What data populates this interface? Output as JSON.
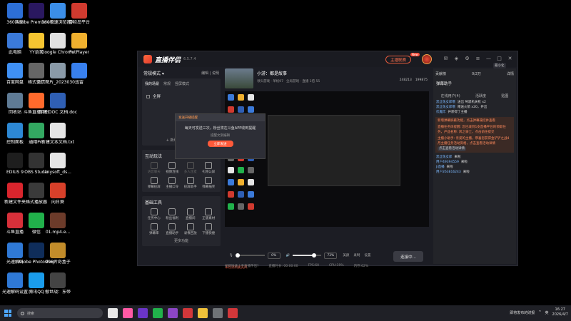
{
  "desktop_icons": [
    {
      "label": "360压缩",
      "color": "#2d6fd6",
      "col": 0,
      "row": 0
    },
    {
      "label": "Adobe Premiere P...",
      "color": "#2a1860",
      "col": 1,
      "row": 0
    },
    {
      "label": "360极速浏览器X",
      "color": "#3b8ee8",
      "col": 2,
      "row": 0
    },
    {
      "label": "冒险岛平台",
      "color": "#d03a2f",
      "col": 3,
      "row": 0
    },
    {
      "label": "此电脑",
      "color": "#3b7ad9",
      "col": 0,
      "row": 1
    },
    {
      "label": "YY语音",
      "color": "#f5c531",
      "col": 1,
      "row": 1
    },
    {
      "label": "Google Chrome",
      "color": "#e0e0e0",
      "col": 2,
      "row": 1
    },
    {
      "label": "PotPlayer",
      "color": "#f0b02e",
      "col": 3,
      "row": 1
    },
    {
      "label": "百度网盘",
      "color": "#3f90f4",
      "col": 0,
      "row": 2
    },
    {
      "label": "格式工厂",
      "color": "#666666",
      "col": 1,
      "row": 2
    },
    {
      "label": "微信图片_2023030...",
      "color": "#8a9aa8",
      "col": 2,
      "row": 2
    },
    {
      "label": "迅雷",
      "color": "#3880ee",
      "col": 3,
      "row": 2
    },
    {
      "label": "回收站",
      "color": "#5f7b95",
      "col": 0,
      "row": 3
    },
    {
      "label": "斗鱼直播伴侣",
      "color": "#ff6a2c",
      "col": 1,
      "row": 3
    },
    {
      "label": "新建 DOC 文档.doc",
      "color": "#2f5fb4",
      "col": 2,
      "row": 3
    },
    {
      "label": "控制面板",
      "color": "#2d88d4",
      "col": 0,
      "row": 4
    },
    {
      "label": "通翔Pro",
      "color": "#33a861",
      "col": 1,
      "row": 4
    },
    {
      "label": "新建文本文档.txt",
      "color": "#e5e5e5",
      "col": 2,
      "row": 4
    },
    {
      "label": "EDIUS 9",
      "color": "#1e1e1e",
      "col": 0,
      "row": 5
    },
    {
      "label": "OBS Studio",
      "color": "#333333",
      "col": 1,
      "row": 5
    },
    {
      "label": "anysoft_ds...",
      "color": "#e5e5e5",
      "col": 2,
      "row": 5
    },
    {
      "label": "新建文件夹",
      "color": "#d9252d",
      "col": 0,
      "row": 6
    },
    {
      "label": "格式播放器",
      "color": "#3a3a3a",
      "col": 1,
      "row": 6
    },
    {
      "label": "向日葵",
      "color": "#d7402a",
      "col": 2,
      "row": 6
    },
    {
      "label": "斗鱼直播",
      "color": "#d7303a",
      "col": 0,
      "row": 7
    },
    {
      "label": "微信",
      "color": "#21b14b",
      "col": 1,
      "row": 7
    },
    {
      "label": "01.mp4.e...",
      "color": "#6c3b2a",
      "col": 2,
      "row": 7
    },
    {
      "label": "光速解码",
      "color": "#2f79d6",
      "col": 0,
      "row": 8
    },
    {
      "label": "Adobe Photoshop",
      "color": "#0f2d5a",
      "col": 1,
      "row": 8
    },
    {
      "label": "996传奇盒子",
      "color": "#c28c2a",
      "col": 2,
      "row": 8
    },
    {
      "label": "光速解码设置",
      "color": "#2f79d6",
      "col": 0,
      "row": 9
    },
    {
      "label": "腾讯QQ",
      "color": "#1a9ceb",
      "col": 1,
      "row": 9
    },
    {
      "label": "傲世战：东帝",
      "color": "#444444",
      "col": 2,
      "row": 9
    }
  ],
  "app": {
    "name": "直播伴侣",
    "version": "6.5.7.4",
    "live_button": "主播联赛",
    "new_badge": "New",
    "tooltip": "最小化",
    "scene": {
      "title": "常规模式 ▾",
      "links": "编辑  |  说明",
      "tabs": [
        "我的场景",
        "常规",
        "竖屏模式"
      ],
      "item": "全屏",
      "add_label": "+ 新增图片/幻灯片"
    },
    "tools_title": "互动玩法",
    "tools": [
      {
        "label": "语音聊天",
        "dim": true
      },
      {
        "label": "视频连线",
        "dim": false
      },
      {
        "label": "多人连麦",
        "dim": true
      },
      {
        "label": "礼物公屏",
        "dim": false
      },
      {
        "label": "弹幕投屏",
        "dim": false
      },
      {
        "label": "主播口令",
        "dim": false
      },
      {
        "label": "投屏助手",
        "dim": false
      },
      {
        "label": "弹幕抽奖",
        "dim": false
      }
    ],
    "base_title": "基础工具",
    "base_tools": [
      {
        "label": "任务中心"
      },
      {
        "label": "粉丝福利"
      },
      {
        "label": "直播间"
      },
      {
        "label": "正版素材"
      },
      {
        "label": "弹幕库"
      },
      {
        "label": "直播助手"
      },
      {
        "label": "录像回放"
      },
      {
        "label": "下播快捷"
      }
    ],
    "more_tools": "更多功能",
    "room": {
      "title": "小游：都是故事",
      "meta": [
        "领头游戏 · 单机97",
        "全局游戏 · 直播 1倍 55"
      ],
      "stats": [
        "248213",
        "199875"
      ]
    },
    "popup": {
      "title": "发送开播提醒",
      "body": "每天可发送三次，粉丝将在斗鱼APP收到提醒",
      "link": "提醒文案编辑",
      "button": "立即发送"
    },
    "controls": {
      "mic_pct": "0%",
      "vol_pct": "73%",
      "vol_level": 0.73,
      "mic_level": 0.05,
      "labels": [
        "麦克风",
        "扬声器",
        "美颜",
        "录制",
        "设置"
      ]
    },
    "start_button": "连接中...",
    "warning": "未检测到麦克风",
    "status": [
      "如何快速上手直播伴侣?",
      "直播时长: 00:00:00",
      "FPS:60",
      "CPU:19%",
      "内存:62%"
    ],
    "right": {
      "head_left": "贡献榜",
      "head_mid": "0/2万",
      "head_right": "详情",
      "sub_title": "弹幕助手",
      "tabs": [
        "在线用户(4)",
        "活跃度",
        "贴图"
      ],
      "chat": [
        {
          "name": "黑丝兔女郎哦",
          "text": "送出 驾驭机关枪 x2"
        },
        {
          "name": "黑丝兔女郎哦",
          "text": "赠送火箭 x20，开出"
        },
        {
          "name": "伏魔炸",
          "text": "并获得了主播"
        }
      ],
      "notice": "新增弹幕屏蔽功能，点击弹幕操控并查看",
      "notice2": "直播任务体提醒: 您已收到1支直播平台的领取任务，产品名称: 风之骑士，点击前往提交",
      "notice3": "主播小助手: 亲爱的主播，恭喜您获得金铲铲之战4月主播任务活动资格，点击查看活动详情",
      "tag": "点击查看活动详情",
      "users": [
        {
          "name": "黑丝兔女郎",
          "action": "来啦"
        },
        {
          "name": "用户49394559",
          "action": "来啦"
        },
        {
          "name": "Ji直播",
          "action": "来啦"
        },
        {
          "name": "用户263816243",
          "action": "来啦"
        }
      ]
    }
  },
  "taskbar": {
    "search_placeholder": "搜索",
    "apps": [
      "#e8e8e8",
      "#ff5aa5",
      "#6b35c7",
      "#21b14b",
      "#8c46c6",
      "#d2373a",
      "#f0c23a",
      "#6f7377",
      "#d2373a"
    ],
    "tray_text": "即将发布的财报",
    "lang": "英",
    "time": "16:27",
    "date": "2026/4/7"
  }
}
